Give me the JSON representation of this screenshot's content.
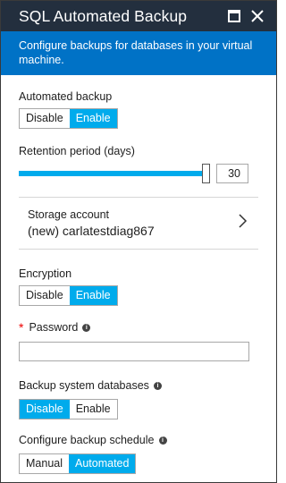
{
  "blade": {
    "title": "SQL Automated Backup",
    "maximize_icon": "maximize-icon",
    "close_icon": "close-icon",
    "description": "Configure backups for databases in your virtual machine."
  },
  "automated_backup": {
    "label": "Automated backup",
    "options": [
      "Disable",
      "Enable"
    ],
    "selected": "Enable"
  },
  "retention": {
    "label": "Retention period (days)",
    "value": "30",
    "level": 1.0
  },
  "storage": {
    "label": "Storage account",
    "value": "(new) carlatestdiag867",
    "chevron_icon": "chevron-right-icon"
  },
  "encryption": {
    "label": "Encryption",
    "options": [
      "Disable",
      "Enable"
    ],
    "selected": "Enable"
  },
  "password": {
    "required_marker": "*",
    "label": "Password",
    "value": ""
  },
  "backup_system_databases": {
    "label": "Backup system databases",
    "options": [
      "Disable",
      "Enable"
    ],
    "selected": "Disable"
  },
  "backup_schedule": {
    "label": "Configure backup schedule",
    "options": [
      "Manual",
      "Automated"
    ],
    "selected": "Automated"
  },
  "colors": {
    "titlebar": "#232f3e",
    "infobar": "#0072c6",
    "accent": "#00abec"
  }
}
